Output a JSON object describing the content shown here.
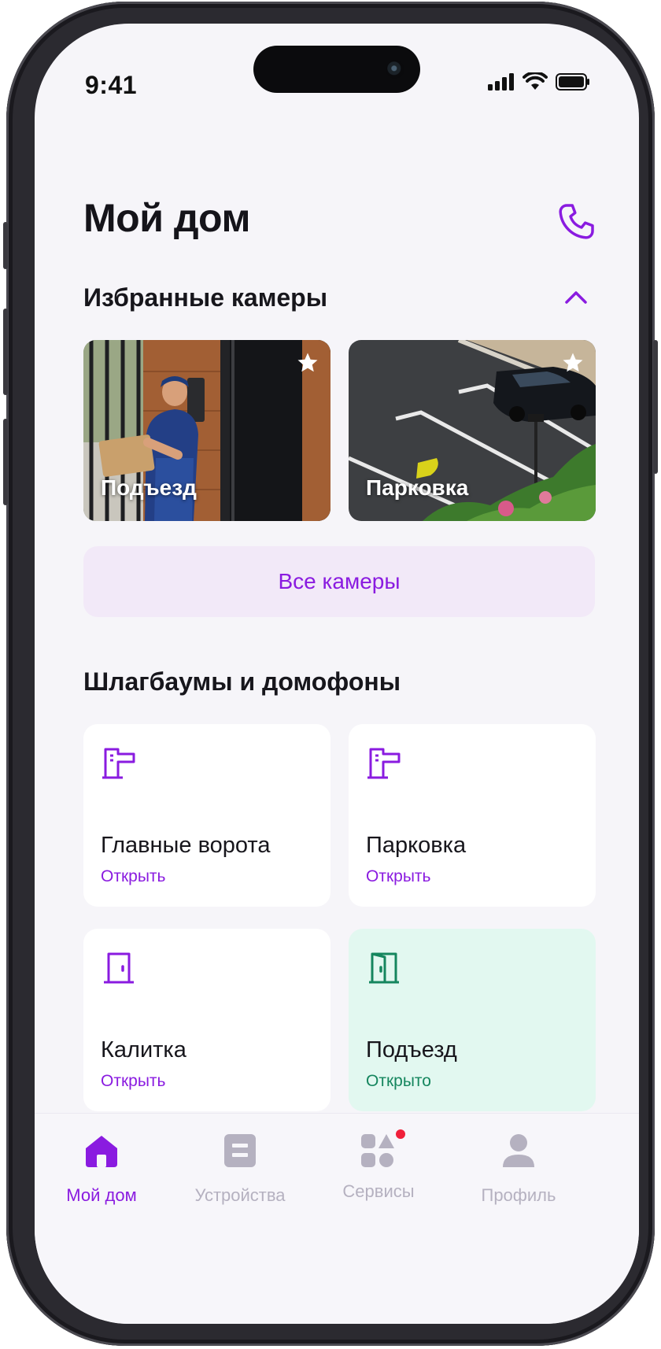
{
  "status_bar": {
    "time": "9:41"
  },
  "header": {
    "title": "Мой дом"
  },
  "favorites": {
    "title": "Избранные камеры",
    "cameras": [
      {
        "label": "Подъезд"
      },
      {
        "label": "Парковка"
      }
    ],
    "all_button": "Все камеры"
  },
  "access": {
    "title": "Шлагбаумы и домофоны",
    "items": [
      {
        "name": "Главные ворота",
        "action": "Открыть",
        "icon": "barrier-icon"
      },
      {
        "name": "Парковка",
        "action": "Открыть",
        "icon": "barrier-icon"
      },
      {
        "name": "Калитка",
        "action": "Открыть",
        "icon": "door-icon"
      },
      {
        "name": "Подъезд",
        "action": "Открыто",
        "icon": "door-open-icon"
      }
    ]
  },
  "tabs": [
    {
      "label": "Мой дом",
      "icon": "home-icon",
      "active": true
    },
    {
      "label": "Устройства",
      "icon": "devices-icon"
    },
    {
      "label": "Сервисы",
      "icon": "services-icon",
      "badge": true
    },
    {
      "label": "Профиль",
      "icon": "profile-icon"
    }
  ],
  "colors": {
    "accent": "#8a1be0",
    "open_green": "#15865e",
    "open_bg": "#e2f8f0",
    "background": "#f6f5f9"
  }
}
